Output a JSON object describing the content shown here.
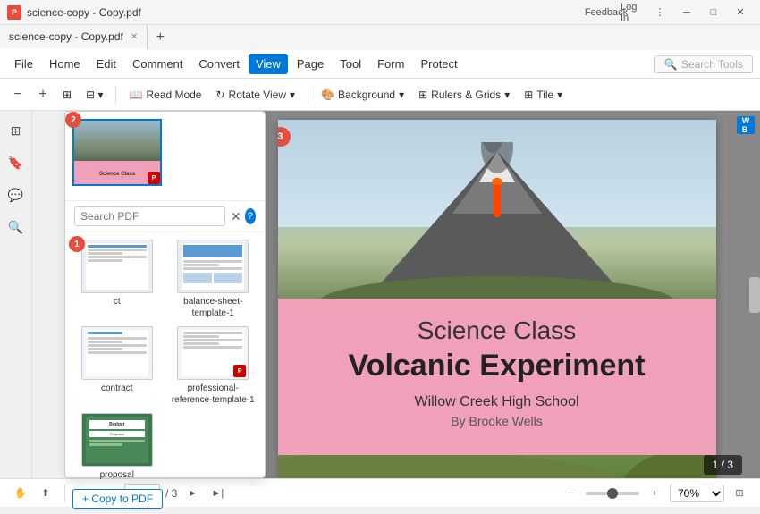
{
  "window": {
    "title": "science-copy - Copy.pdf",
    "tab_label": "science-copy - Copy.pdf"
  },
  "menu": {
    "file": "File",
    "home": "Home",
    "edit": "Edit",
    "comment": "Comment",
    "convert": "Convert",
    "view": "View",
    "page": "Page",
    "tool": "Tool",
    "form": "Form",
    "protect": "Protect",
    "search_tools": "Search Tools",
    "feedback": "Feedback",
    "login": "Log In"
  },
  "toolbar": {
    "read_mode": "Read Mode",
    "rotate_view": "Rotate View",
    "background": "Background",
    "rulers_grids": "Rulers & Grids",
    "tile": "Tile"
  },
  "pdf_panel": {
    "search_placeholder": "Search PDF",
    "copy_btn": "+ Copy to PDF",
    "items": [
      {
        "label": "ct",
        "name": "ct"
      },
      {
        "label": "balance-sheet-template-1",
        "name": "balance-sheet-template-1"
      },
      {
        "label": "contract",
        "name": "contract"
      },
      {
        "label": "professional-reference-template-1",
        "name": "professional-reference-template-1"
      },
      {
        "label": "proposal",
        "name": "proposal"
      }
    ]
  },
  "page": {
    "title_line1": "Science Class",
    "title_line2": "Volcanic Experiment",
    "school": "Willow Creek High School",
    "author": "By Brooke Wells"
  },
  "navigation": {
    "current_page": "1",
    "total_pages": "/ 3",
    "page_display": "1 / 3",
    "zoom": "70%"
  },
  "badges": {
    "badge_1": "1",
    "badge_2": "2",
    "badge_3": "3"
  }
}
